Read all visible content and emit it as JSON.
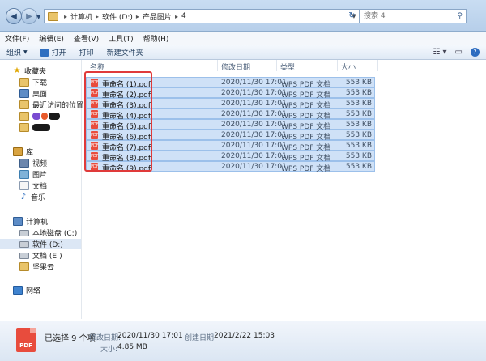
{
  "address": {
    "crumbs": [
      "计算机",
      "软件 (D:)",
      "产品图片",
      "4"
    ]
  },
  "search": {
    "placeholder": "搜索 4"
  },
  "menu": [
    "文件(F)",
    "编辑(E)",
    "查看(V)",
    "工具(T)",
    "帮助(H)"
  ],
  "toolbar": {
    "organize": "组织",
    "open": "打开",
    "print": "打印",
    "new_folder": "新建文件夹"
  },
  "sidebar": {
    "favorites": "收藏夹",
    "downloads": "下载",
    "desktop": "桌面",
    "recent": "最近访问的位置",
    "libraries": "库",
    "videos": "视频",
    "pictures": "图片",
    "documents": "文档",
    "music": "音乐",
    "computer": "计算机",
    "drive_c": "本地磁盘 (C:)",
    "drive_d": "软件 (D:)",
    "drive_e": "文档 (E:)",
    "cloud": "坚果云",
    "network": "网络"
  },
  "columns": {
    "name": "名称",
    "date": "修改日期",
    "type": "类型",
    "size": "大小"
  },
  "files": [
    {
      "name": "重命名 (1).pdf",
      "date": "2020/11/30 17:01",
      "type": "WPS PDF 文档",
      "size": "553 KB"
    },
    {
      "name": "重命名 (2).pdf",
      "date": "2020/11/30 17:01",
      "type": "WPS PDF 文档",
      "size": "553 KB"
    },
    {
      "name": "重命名 (3).pdf",
      "date": "2020/11/30 17:01",
      "type": "WPS PDF 文档",
      "size": "553 KB"
    },
    {
      "name": "重命名 (4).pdf",
      "date": "2020/11/30 17:01",
      "type": "WPS PDF 文档",
      "size": "553 KB"
    },
    {
      "name": "重命名 (5).pdf",
      "date": "2020/11/30 17:01",
      "type": "WPS PDF 文档",
      "size": "553 KB"
    },
    {
      "name": "重命名 (6).pdf",
      "date": "2020/11/30 17:01",
      "type": "WPS PDF 文档",
      "size": "553 KB"
    },
    {
      "name": "重命名 (7).pdf",
      "date": "2020/11/30 17:01",
      "type": "WPS PDF 文档",
      "size": "553 KB"
    },
    {
      "name": "重命名 (8).pdf",
      "date": "2020/11/30 17:01",
      "type": "WPS PDF 文档",
      "size": "553 KB"
    },
    {
      "name": "重命名 (9).pdf",
      "date": "2020/11/30 17:01",
      "type": "WPS PDF 文档",
      "size": "553 KB"
    }
  ],
  "details": {
    "icon_label": "PDF",
    "selected": "已选择 9 个项",
    "modified_label": "修改日期:",
    "modified_value": "2020/11/30 17:01",
    "created_label": "创建日期:",
    "created_value": "2021/2/22 15:03",
    "size_label": "大小:",
    "size_value": "4.85 MB"
  },
  "colors": {
    "selection": "#cfe1f7",
    "highlight_box": "#e03a3a",
    "pdf_red": "#e84c3d"
  }
}
